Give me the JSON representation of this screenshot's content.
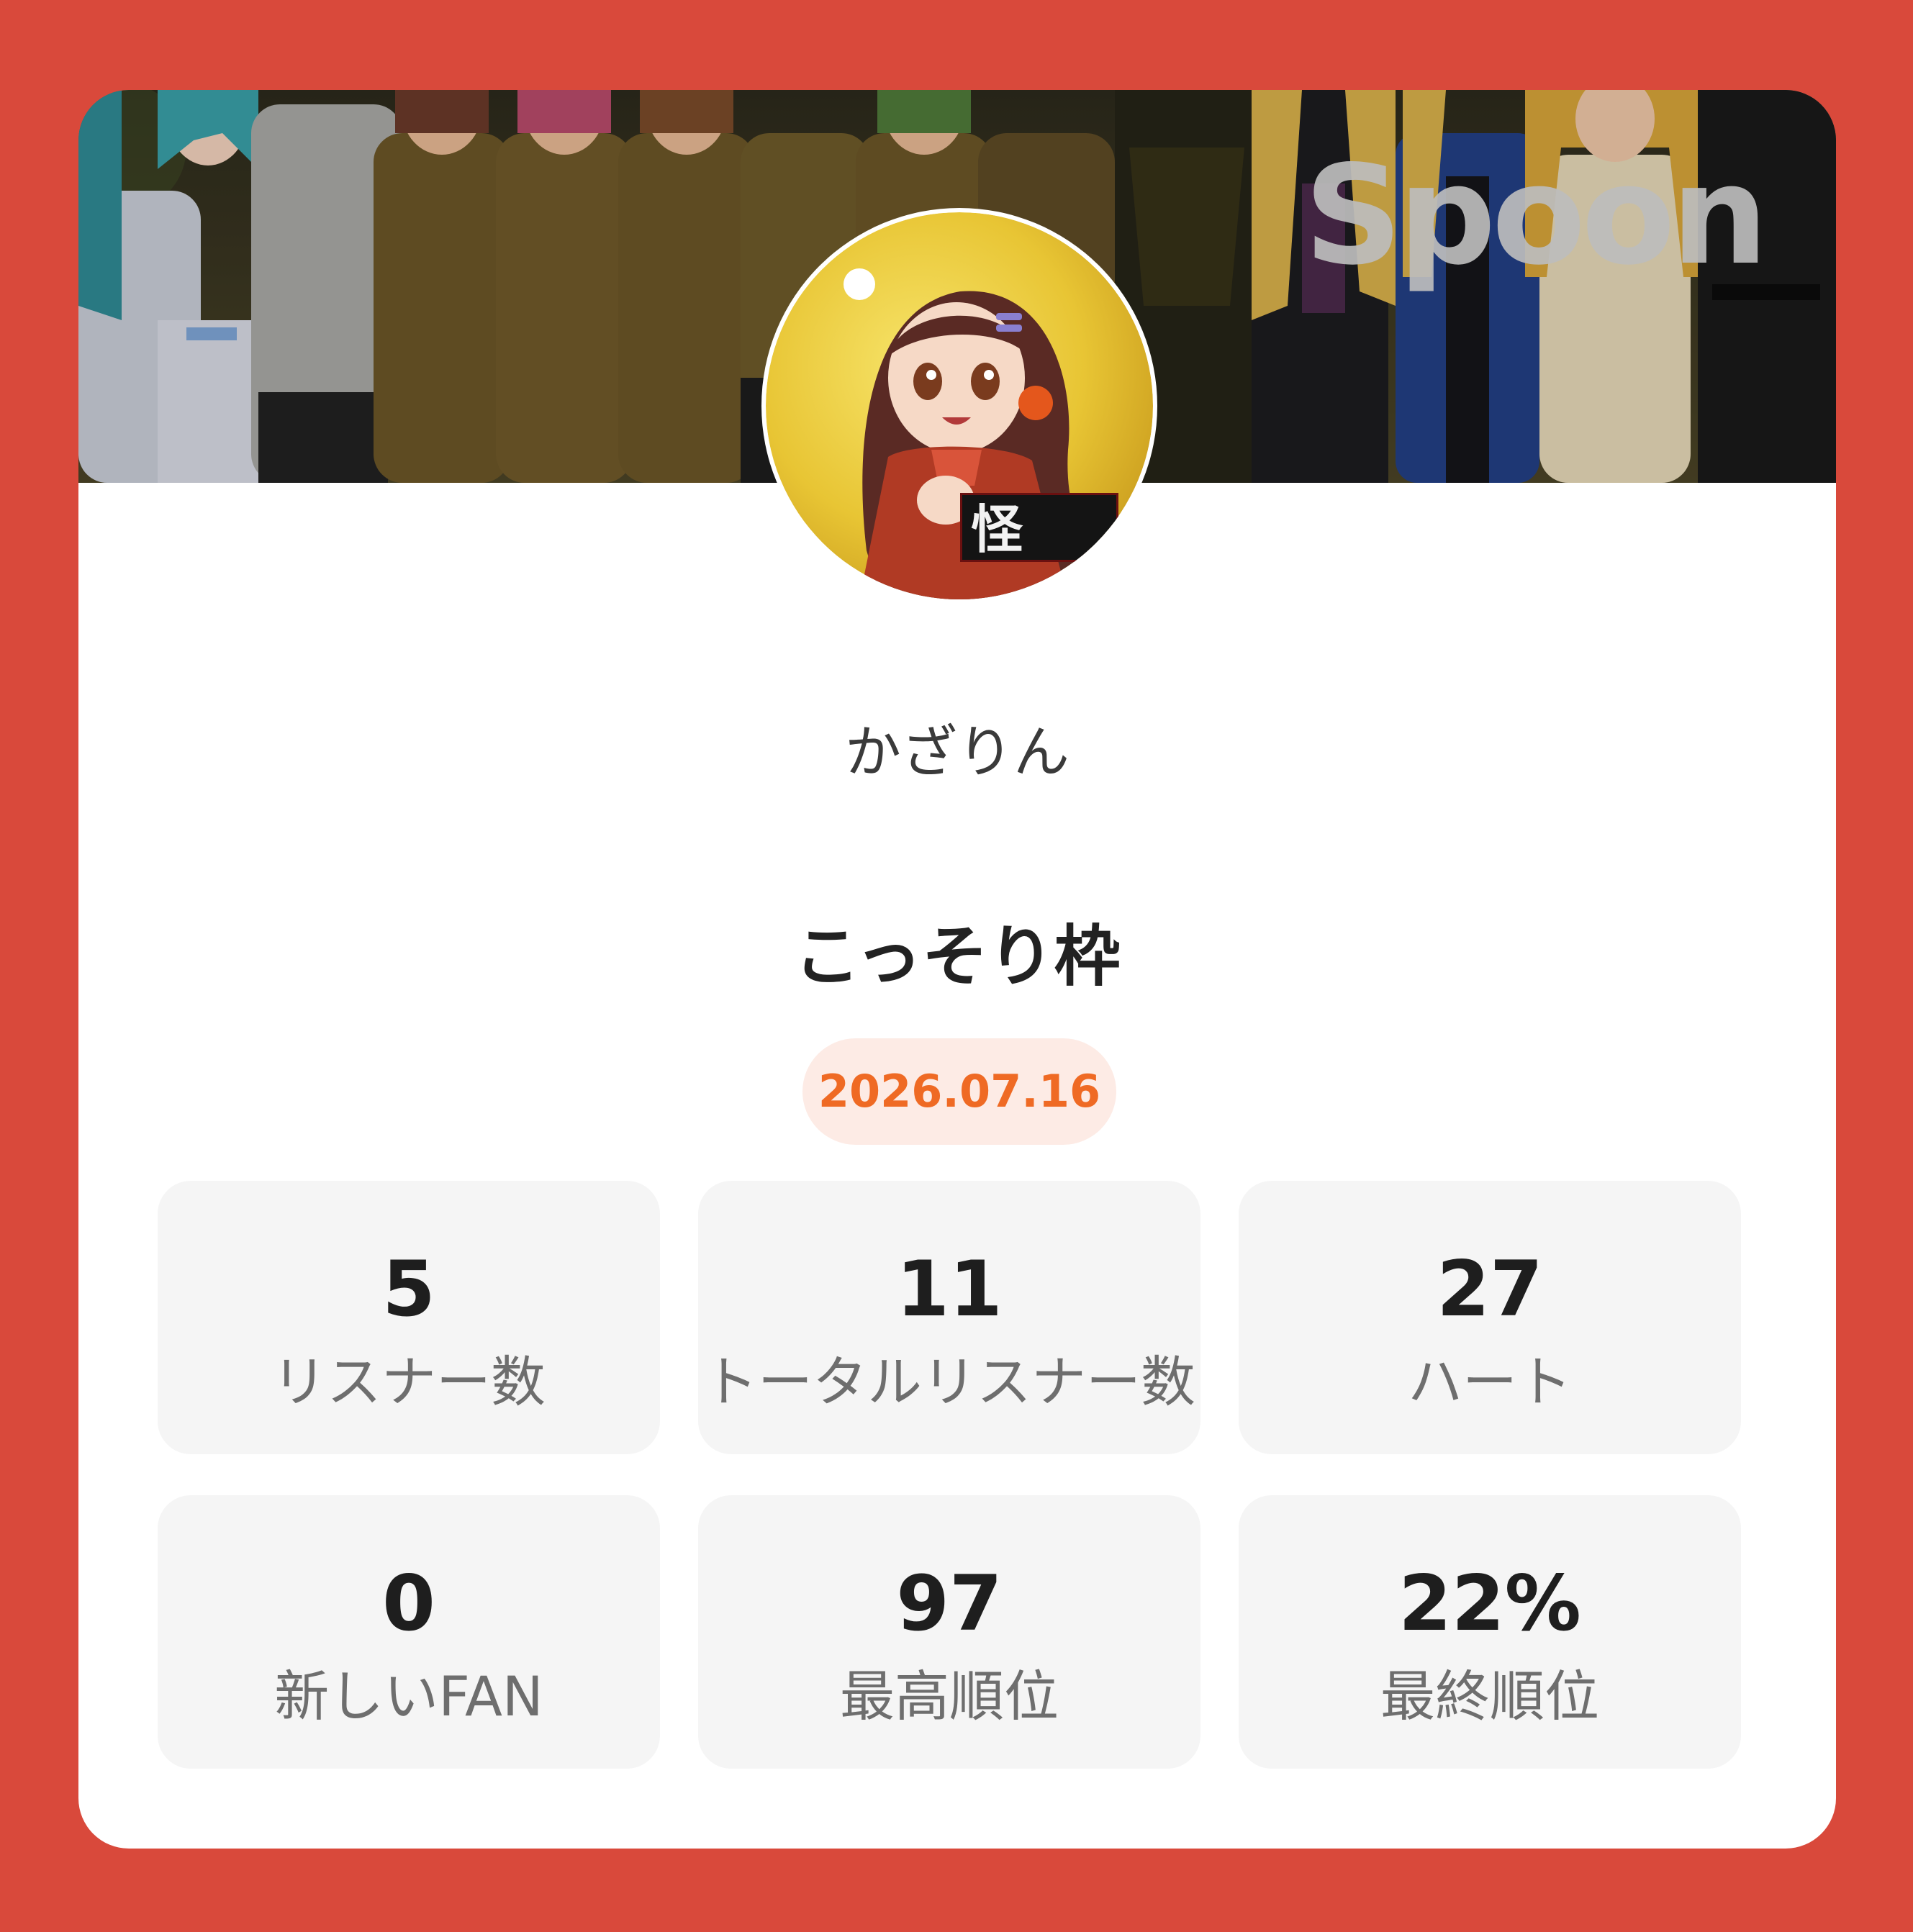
{
  "brand": {
    "logo_text": "Spoon"
  },
  "profile": {
    "username": "かざりん",
    "avatar_badge_text": "怪"
  },
  "broadcast": {
    "title": "こっそり枠",
    "date": "2026.07.16"
  },
  "stats": [
    {
      "value": "5",
      "label": "リスナー数"
    },
    {
      "value": "11",
      "label": "トータルリスナー数"
    },
    {
      "value": "27",
      "label": "ハート"
    },
    {
      "value": "0",
      "label": "新しいFAN"
    },
    {
      "value": "97",
      "label": "最高順位"
    },
    {
      "value": "22%",
      "label": "最終順位"
    }
  ],
  "colors": {
    "background": "#d9493b",
    "card": "#ffffff",
    "accent": "#ef6a24",
    "pill_background": "#fdebe5",
    "stat_tile": "#f5f5f5"
  }
}
